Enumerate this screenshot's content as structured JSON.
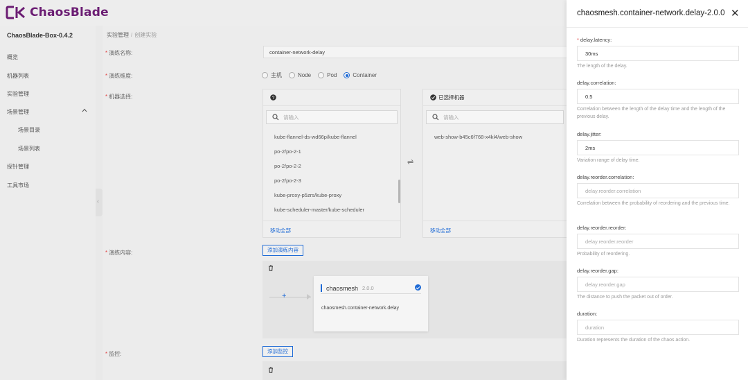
{
  "app": {
    "brand": "ChaosBlade",
    "version": "ChaosBlade-Box-0.4.2"
  },
  "sidebar": {
    "items": [
      {
        "label": "概览"
      },
      {
        "label": "机器列表"
      },
      {
        "label": "实验管理"
      },
      {
        "label": "场景管理"
      },
      {
        "label": "场景目录"
      },
      {
        "label": "场景列表"
      },
      {
        "label": "探针管理"
      },
      {
        "label": "工具市场"
      }
    ]
  },
  "breadcrumb": {
    "parent": "实验管理",
    "separator": "/",
    "current": "创建实验"
  },
  "form": {
    "name_label": "演练名称:",
    "name_value": "container-network-delay",
    "dimension_label": "演练维度:",
    "dimensions": [
      "主机",
      "Node",
      "Pod",
      "Container"
    ],
    "dimension_selected": "Container",
    "machine_label": "机器选择:",
    "transfer": {
      "left_title": "",
      "right_title": "已选择机器",
      "search_placeholder": "请输入",
      "left_items": [
        "kube-flannel-ds-wd66p/kube-flannel",
        "po-2/po-2-1",
        "po-2/po-2-2",
        "po-2/po-2-3",
        "kube-proxy-p5zrs/kube-proxy",
        "kube-scheduler-master/kube-scheduler"
      ],
      "right_items": [
        "web-show-b45c6f768-x4kl4/web-show"
      ],
      "footer_action": "移动全部",
      "arrow": "⇌"
    },
    "content_label": "演练内容:",
    "add_content_button": "添加演练内容",
    "flow": {
      "plus": "+",
      "node_title": "chaosmesh",
      "node_version": "2.0.0",
      "node_action": "chaosmesh.container-network.delay"
    },
    "monitor_label": "监控:",
    "add_monitor_button": "添加监控"
  },
  "drawer": {
    "title": "chaosmesh.container-network.delay-2.0.0",
    "close": "✕",
    "fields": [
      {
        "label": "delay.latency:",
        "required": true,
        "value": "30ms",
        "placeholder": "",
        "help": "The length of the delay."
      },
      {
        "label": "delay.correlation:",
        "required": false,
        "value": "0.5",
        "placeholder": "",
        "help": "Correlation between the length of the delay time and the length of the previous delay."
      },
      {
        "label": "delay.jitter:",
        "required": false,
        "value": "2ms",
        "placeholder": "",
        "help": "Variation range of delay time."
      },
      {
        "label": "delay.reorder.correlation:",
        "required": false,
        "value": "",
        "placeholder": "delay.reorder.correlation",
        "help": "Correlation between the probability of reordering and the previous time."
      },
      {
        "label": "delay.reorder.reorder:",
        "required": false,
        "value": "",
        "placeholder": "delay.reorder.reorder",
        "help": "Probability of reordering."
      },
      {
        "label": "delay.reorder.gap:",
        "required": false,
        "value": "",
        "placeholder": "delay.reorder.gap",
        "help": "The distance to push the packet out of order."
      },
      {
        "label": "duration:",
        "required": false,
        "value": "",
        "placeholder": "duration",
        "help": "Duration represents the duration of the chaos action."
      }
    ]
  },
  "colors": {
    "brand": "#6b1d73",
    "primary": "#1f6bd6",
    "required": "#e04545"
  }
}
